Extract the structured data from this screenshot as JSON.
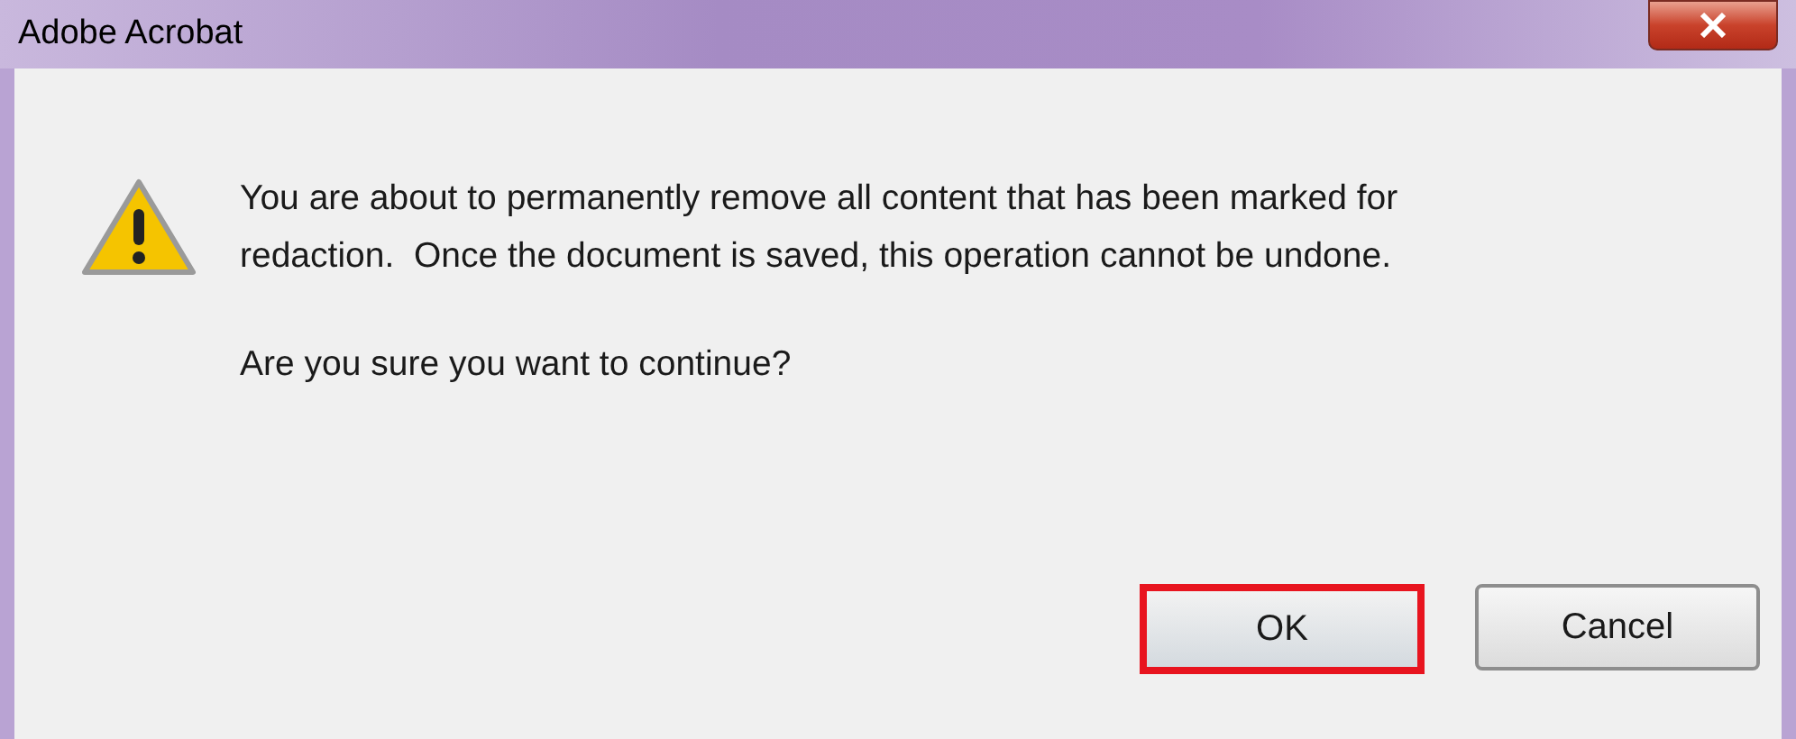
{
  "window": {
    "title": "Adobe Acrobat"
  },
  "message": {
    "lines": [
      "You are about to permanently remove all content that has been marked for",
      "redaction.  Once the document is saved, this operation cannot be undone."
    ],
    "question": "Are you sure you want to continue?"
  },
  "buttons": [
    {
      "label": "OK",
      "highlighted": true
    },
    {
      "label": "Cancel",
      "highlighted": false
    }
  ]
}
